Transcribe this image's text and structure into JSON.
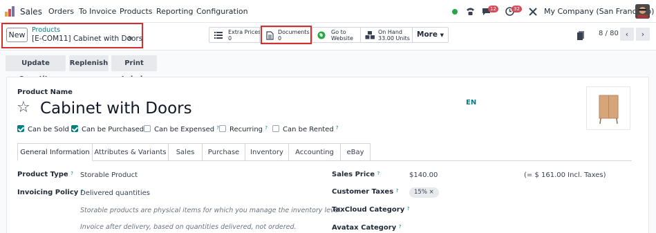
{
  "navbar": {
    "app_name": "Sales",
    "menu": [
      "Orders",
      "To Invoice",
      "Products",
      "Reporting",
      "Configuration"
    ],
    "messages_count": "12",
    "activities_count": "32",
    "company": "My Company (San Francisco)"
  },
  "control_panel": {
    "new_label": "New",
    "breadcrumb_parent": "Products",
    "breadcrumb_current": "[E-COM11] Cabinet with Doors",
    "stat_buttons": [
      {
        "line1": "Extra Prices",
        "line2": "0"
      },
      {
        "line1": "Documents",
        "line2": "0"
      },
      {
        "line1": "Go to",
        "line2": "Website"
      },
      {
        "line1": "On Hand",
        "line2": "33.00 Units"
      }
    ],
    "more_label": "More",
    "pager": "8 / 80"
  },
  "actions": [
    "Update Quantity",
    "Replenish",
    "Print Labels"
  ],
  "form": {
    "name_label": "Product Name",
    "product_name": "Cabinet with Doors",
    "lang": "EN",
    "checkboxes": [
      {
        "label": "Can be Sold",
        "checked": true
      },
      {
        "label": "Can be Purchased",
        "checked": true
      },
      {
        "label": "Can be Expensed",
        "checked": false
      },
      {
        "label": "Recurring",
        "checked": false
      },
      {
        "label": "Can be Rented",
        "checked": false
      }
    ],
    "tabs": [
      "General Information",
      "Attributes & Variants",
      "Sales",
      "Purchase",
      "Inventory",
      "Accounting",
      "eBay"
    ],
    "product_type_label": "Product Type",
    "product_type_value": "Storable Product",
    "invoicing_policy_label": "Invoicing Policy",
    "invoicing_policy_value": "Delivered quantities",
    "help_1": "Storable products are physical items for which you manage the inventory level.",
    "help_2": "Invoice after delivery, based on quantities delivered, not ordered.",
    "sales_price_label": "Sales Price",
    "sales_price_value": "$140.00",
    "incl_taxes": "(= $ 161.00 Incl. Taxes)",
    "customer_taxes_label": "Customer Taxes",
    "customer_tax_tag": "15%",
    "taxcloud_label": "TaxCloud Category",
    "avatax_label": "Avatax Category"
  },
  "colors": {
    "accent": "#017e84",
    "highlight": "#d32f2f",
    "badge": "#d44c59"
  }
}
